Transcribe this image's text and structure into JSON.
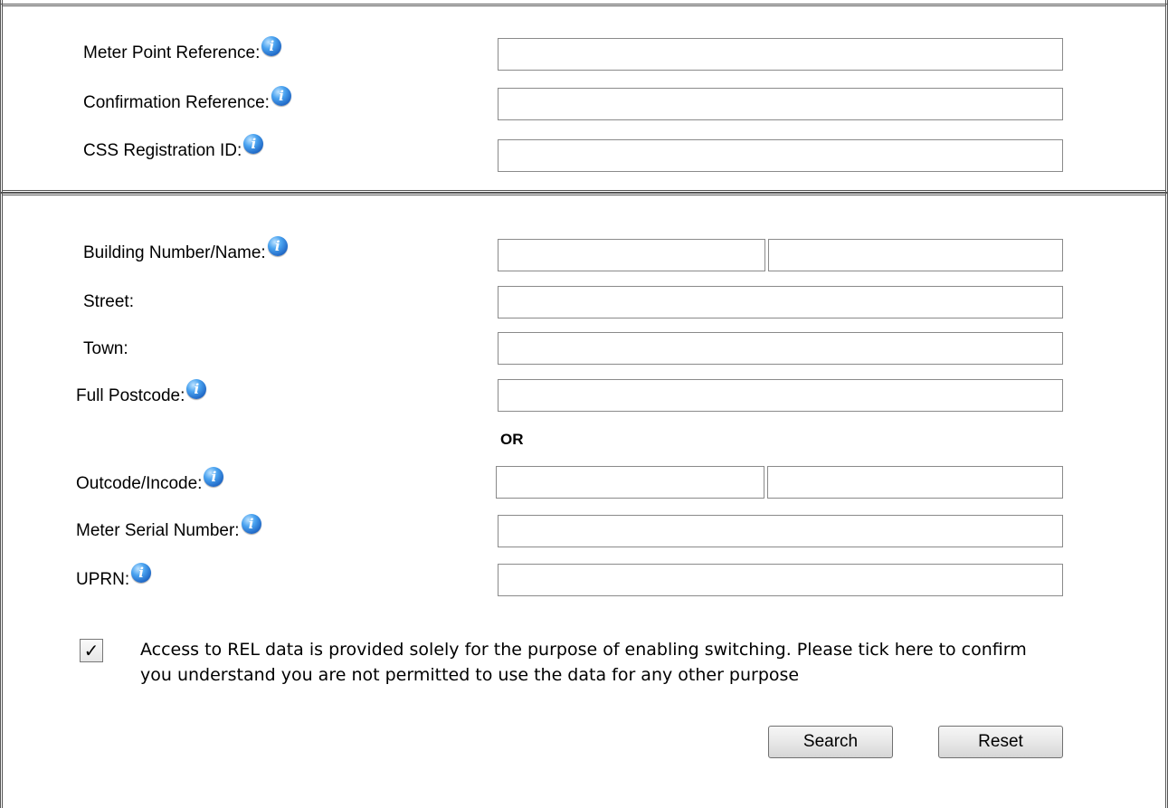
{
  "reference_section": {
    "meter_point_reference": {
      "label": "Meter Point Reference:",
      "value": ""
    },
    "confirmation_reference": {
      "label": "Confirmation Reference:",
      "value": ""
    },
    "css_registration_id": {
      "label": "CSS Registration ID:",
      "value": ""
    }
  },
  "address_section": {
    "building_number_name": {
      "label": "Building Number/Name:",
      "value_number": "",
      "value_name": ""
    },
    "street": {
      "label": "Street:",
      "value": ""
    },
    "town": {
      "label": "Town:",
      "value": ""
    },
    "full_postcode": {
      "label": "Full Postcode:",
      "value": ""
    },
    "or_text": "OR",
    "outcode_incode": {
      "label": "Outcode/Incode:",
      "value_outcode": "",
      "value_incode": ""
    },
    "meter_serial_number": {
      "label": "Meter Serial Number:",
      "value": ""
    },
    "uprn": {
      "label": "UPRN:",
      "value": ""
    }
  },
  "info_icon": {
    "glyph": "i",
    "color": "#1a5fbf"
  },
  "consent": {
    "checked": true,
    "check_glyph": "✓",
    "text": "Access to REL data is provided solely for the purpose of enabling switching. Please tick here to confirm you understand you are not permitted to use the data for any other purpose"
  },
  "buttons": {
    "search": "Search",
    "reset": "Reset"
  }
}
